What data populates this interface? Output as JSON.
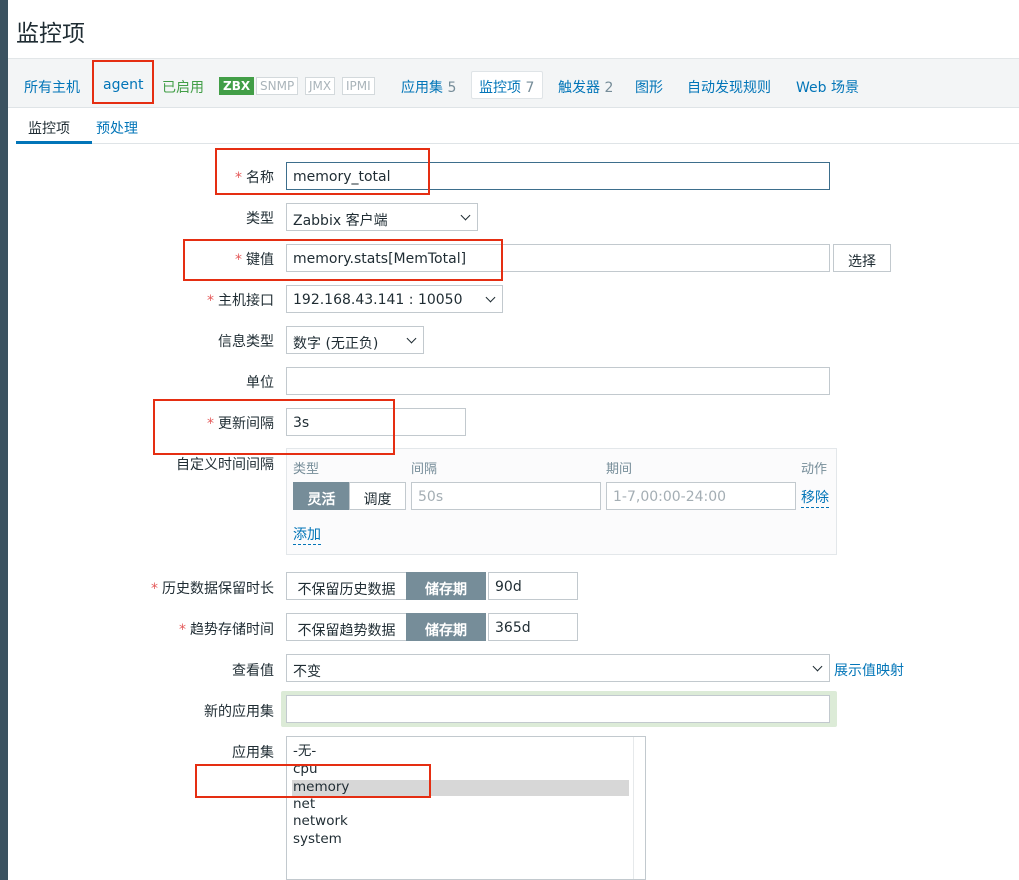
{
  "page": {
    "title": "监控项"
  },
  "host_nav": {
    "all_hosts": "所有主机",
    "host": "agent",
    "enabled": "已启用",
    "badges": [
      "ZBX",
      "SNMP",
      "JMX",
      "IPMI"
    ],
    "tabs": [
      {
        "label": "应用集",
        "count": "5"
      },
      {
        "label": "监控项",
        "count": "7"
      },
      {
        "label": "触发器",
        "count": "2"
      },
      {
        "label": "图形",
        "count": ""
      },
      {
        "label": "自动发现规则",
        "count": ""
      },
      {
        "label": "Web 场景",
        "count": ""
      }
    ]
  },
  "form_tabs": [
    "监控项",
    "预处理"
  ],
  "form": {
    "name": {
      "label": "名称",
      "value": "memory_total"
    },
    "type": {
      "label": "类型",
      "value": "Zabbix 客户端"
    },
    "key": {
      "label": "键值",
      "value": "memory.stats[MemTotal]",
      "select_button": "选择"
    },
    "interface": {
      "label": "主机接口",
      "value": "192.168.43.141 : 10050"
    },
    "info_type": {
      "label": "信息类型",
      "value": "数字 (无正负)"
    },
    "units": {
      "label": "单位",
      "value": ""
    },
    "interval": {
      "label": "更新间隔",
      "value": "3s"
    },
    "custom_intervals": {
      "label": "自定义时间间隔",
      "headers": [
        "类型",
        "间隔",
        "期间",
        "动作"
      ],
      "modes": [
        "灵活",
        "调度"
      ],
      "interval_placeholder": "50s",
      "period_placeholder": "1-7,00:00-24:00",
      "remove": "移除",
      "add": "添加"
    },
    "history": {
      "label": "历史数据保留时长",
      "off": "不保留历史数据",
      "on": "储存期",
      "value": "90d"
    },
    "trends": {
      "label": "趋势存储时间",
      "off": "不保留趋势数据",
      "on": "储存期",
      "value": "365d"
    },
    "show_value": {
      "label": "查看值",
      "value": "不变",
      "link": "展示值映射"
    },
    "new_app": {
      "label": "新的应用集",
      "value": ""
    },
    "apps": {
      "label": "应用集",
      "options": [
        "-无-",
        "cpu",
        "memory",
        "net",
        "network",
        "system"
      ],
      "selected": "memory"
    }
  }
}
